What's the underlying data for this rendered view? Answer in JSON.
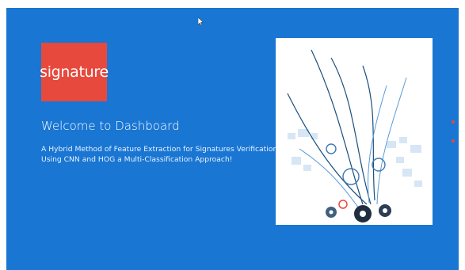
{
  "logo": {
    "text": "signature"
  },
  "header": {
    "title": "Welcome to Dashboard"
  },
  "main": {
    "subtitle": "A Hybrid Method of Feature Extraction for Signatures Verification Using CNN and HOG a Multi-Classification Approach!"
  },
  "colors": {
    "background": "#1976d2",
    "logo_background": "#e8493d",
    "indicator": "#e8493d"
  },
  "carousel": {
    "indicator_count": 2
  },
  "icons": [
    "mouse-cursor-icon",
    "carousel-dot-icon"
  ]
}
